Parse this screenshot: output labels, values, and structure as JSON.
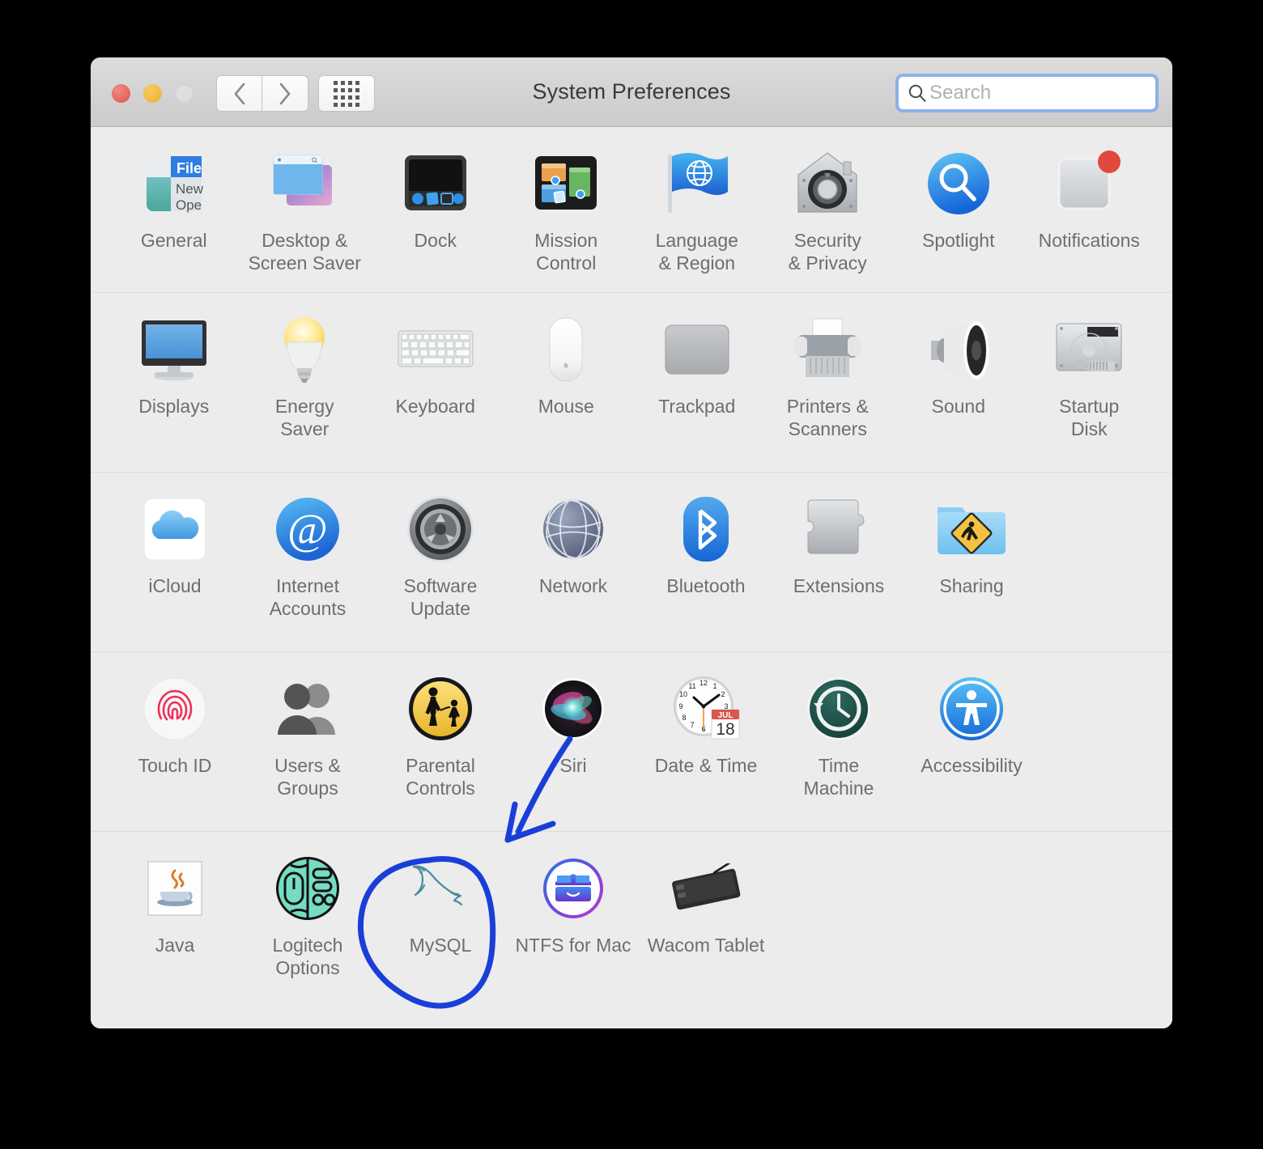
{
  "window": {
    "title": "System Preferences",
    "traffic_lights": [
      "close",
      "minimize",
      "zoom"
    ],
    "nav": {
      "back_label": "‹",
      "forward_label": "›",
      "grid_label": "show-all"
    }
  },
  "search": {
    "placeholder": "Search",
    "value": "",
    "focused": true,
    "focus_ring_color": "#8cb2e8"
  },
  "colors": {
    "window_bg": "#ececec",
    "toolbar_top": "#dcdcdc",
    "toolbar_bottom": "#cbcbcb",
    "label_text": "#6e6e6e",
    "title_text": "#3a3a3a",
    "divider": "#dcdcdc",
    "annotation_blue": "#1a3fd8"
  },
  "rows": [
    {
      "index": 1,
      "items": [
        {
          "label": "General",
          "icon": "general-icon"
        },
        {
          "label": "Desktop &\nScreen Saver",
          "icon": "desktop-screensaver-icon"
        },
        {
          "label": "Dock",
          "icon": "dock-icon"
        },
        {
          "label": "Mission\nControl",
          "icon": "mission-control-icon"
        },
        {
          "label": "Language\n& Region",
          "icon": "language-region-icon"
        },
        {
          "label": "Security\n& Privacy",
          "icon": "security-privacy-icon"
        },
        {
          "label": "Spotlight",
          "icon": "spotlight-icon"
        },
        {
          "label": "Notifications",
          "icon": "notifications-icon",
          "badge": true
        }
      ]
    },
    {
      "index": 2,
      "items": [
        {
          "label": "Displays",
          "icon": "displays-icon"
        },
        {
          "label": "Energy\nSaver",
          "icon": "energy-saver-icon"
        },
        {
          "label": "Keyboard",
          "icon": "keyboard-icon"
        },
        {
          "label": "Mouse",
          "icon": "mouse-icon"
        },
        {
          "label": "Trackpad",
          "icon": "trackpad-icon"
        },
        {
          "label": "Printers &\nScanners",
          "icon": "printers-scanners-icon"
        },
        {
          "label": "Sound",
          "icon": "sound-icon"
        },
        {
          "label": "Startup\nDisk",
          "icon": "startup-disk-icon"
        }
      ]
    },
    {
      "index": 3,
      "items": [
        {
          "label": "iCloud",
          "icon": "icloud-icon"
        },
        {
          "label": "Internet\nAccounts",
          "icon": "internet-accounts-icon"
        },
        {
          "label": "Software\nUpdate",
          "icon": "software-update-icon"
        },
        {
          "label": "Network",
          "icon": "network-icon"
        },
        {
          "label": "Bluetooth",
          "icon": "bluetooth-icon"
        },
        {
          "label": "Extensions",
          "icon": "extensions-icon"
        },
        {
          "label": "Sharing",
          "icon": "sharing-icon"
        }
      ]
    },
    {
      "index": 4,
      "items": [
        {
          "label": "Touch ID",
          "icon": "touch-id-icon"
        },
        {
          "label": "Users &\nGroups",
          "icon": "users-groups-icon"
        },
        {
          "label": "Parental\nControls",
          "icon": "parental-controls-icon"
        },
        {
          "label": "Siri",
          "icon": "siri-icon"
        },
        {
          "label": "Date & Time",
          "icon": "date-time-icon",
          "clock_month": "JUL",
          "clock_day": "18"
        },
        {
          "label": "Time\nMachine",
          "icon": "time-machine-icon"
        },
        {
          "label": "Accessibility",
          "icon": "accessibility-icon"
        }
      ]
    },
    {
      "index": 5,
      "items": [
        {
          "label": "Java",
          "icon": "java-icon"
        },
        {
          "label": "Logitech Options",
          "icon": "logitech-options-icon"
        },
        {
          "label": "MySQL",
          "icon": "mysql-icon",
          "annotated": true
        },
        {
          "label": "NTFS for Mac",
          "icon": "ntfs-for-mac-icon"
        },
        {
          "label": "Wacom Tablet",
          "icon": "wacom-tablet-icon"
        }
      ]
    }
  ],
  "annotations": [
    {
      "type": "arrow",
      "name": "siri-arrow-annotation",
      "color": "#1a3fd8",
      "from": "siri-icon",
      "direction": "down-left"
    },
    {
      "type": "circle",
      "name": "mysql-circle-annotation",
      "color": "#1a3fd8",
      "target": "mysql-icon"
    }
  ]
}
